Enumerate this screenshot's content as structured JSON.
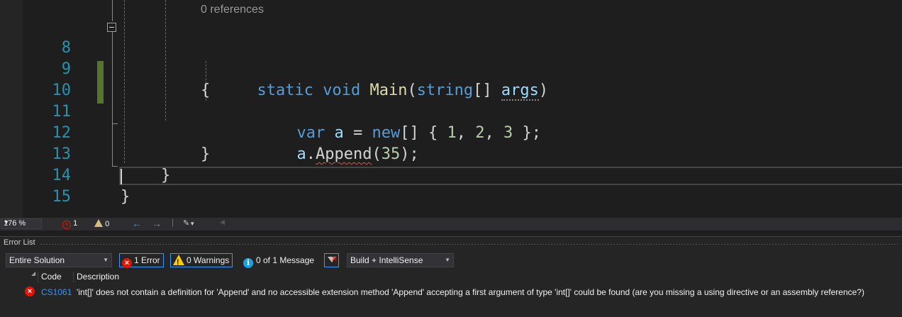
{
  "editor": {
    "codelens": "0 references",
    "lines": [
      {
        "num": "8"
      },
      {
        "num": "9"
      },
      {
        "num": "10"
      },
      {
        "num": "11"
      },
      {
        "num": "12"
      },
      {
        "num": "13"
      },
      {
        "num": "14"
      },
      {
        "num": "15"
      }
    ],
    "code": {
      "l8_static": "static",
      "l8_void": "void",
      "l8_main": "Main",
      "l8_paren_open": "(",
      "l8_string": "string",
      "l8_brackets": "[]",
      "l8_args": "args",
      "l8_paren_close": ")",
      "l9_brace": "{",
      "l10_var": "var",
      "l10_a": "a",
      "l10_eq": "=",
      "l10_new": "new",
      "l10_rest_open": "[] {",
      "l10_n1": "1",
      "l10_c1": ",",
      "l10_n2": "2",
      "l10_c2": ",",
      "l10_n3": "3",
      "l10_close": "};",
      "l11_a": "a",
      "l11_dot": ".",
      "l11_append": "Append",
      "l11_open": "(",
      "l11_num": "35",
      "l11_close": ");",
      "l12_brace": "}",
      "l13_brace": "}",
      "l14_brace": "}"
    }
  },
  "statusbar": {
    "zoom": "176 %",
    "errors": "1",
    "warnings": "0"
  },
  "error_list": {
    "title": "Error List",
    "scope": "Entire Solution",
    "errors_btn": "1 Error",
    "warnings_btn": "0 Warnings",
    "messages_btn": "0 of 1 Message",
    "build_filter": "Build + IntelliSense",
    "columns": {
      "code": "Code",
      "description": "Description"
    },
    "rows": [
      {
        "code": "CS1061",
        "description": "'int[]' does not contain a definition for 'Append' and no accessible extension method 'Append' accepting a first argument of type 'int[]' could be found (are you missing a using directive or an assembly reference?)"
      }
    ]
  },
  "colors": {
    "background": "#1e1e1e",
    "line_number": "#2b91af",
    "keyword": "#569cd6",
    "error": "#e51400",
    "change_margin": "#57742e"
  }
}
